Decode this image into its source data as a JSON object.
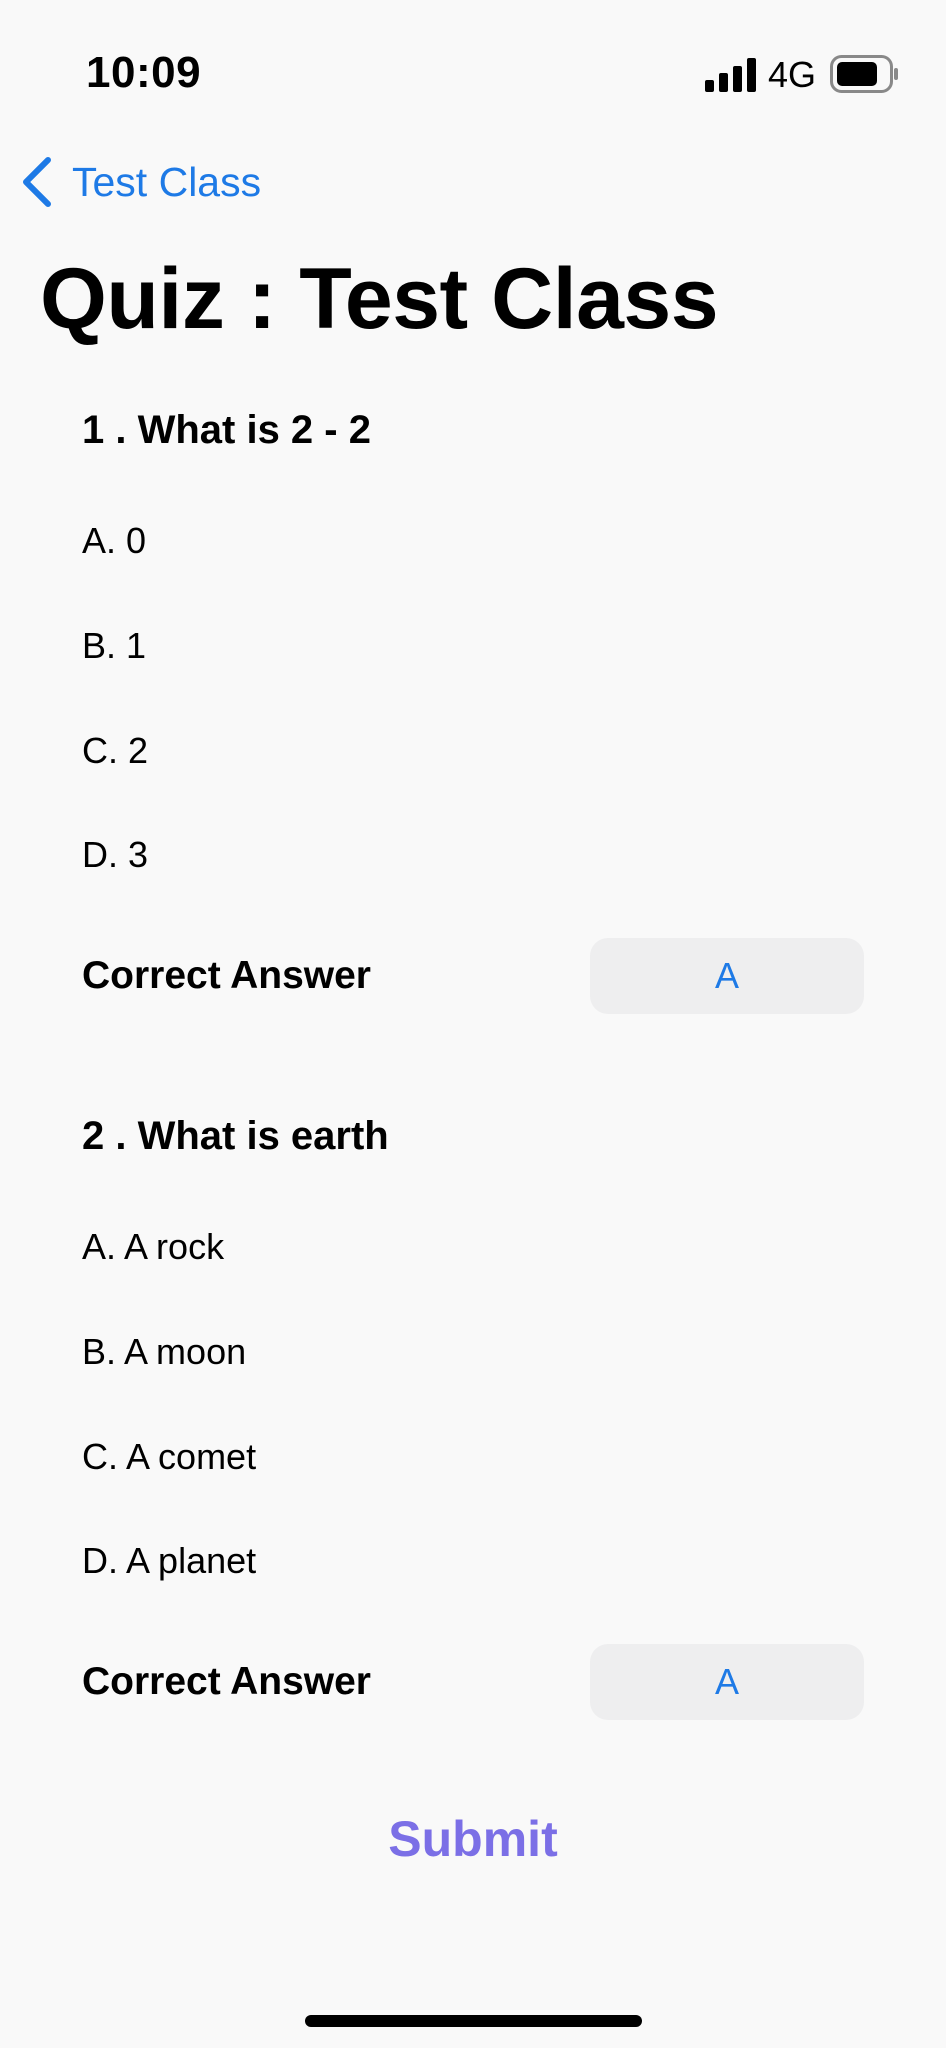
{
  "status_bar": {
    "time": "10:09",
    "network": "4G",
    "icons": [
      "signal-icon",
      "battery-icon"
    ]
  },
  "nav": {
    "back_label": "Test Class",
    "back_icon": "chevron-left-icon",
    "accent_color": "#1e7ae6"
  },
  "page_title": "Quiz : Test Class",
  "questions": [
    {
      "text": "1 . What is 2 - 2",
      "options": [
        "A. 0",
        "B. 1",
        "C. 2",
        "D. 3"
      ],
      "correct_label": "Correct Answer",
      "correct_value": "A"
    },
    {
      "text": "2 . What is earth",
      "options": [
        "A. A rock",
        "B. A moon",
        "C. A comet",
        "D. A planet"
      ],
      "correct_label": "Correct Answer",
      "correct_value": "A"
    }
  ],
  "submit_label": "Submit",
  "submit_color": "#7b6fe6"
}
